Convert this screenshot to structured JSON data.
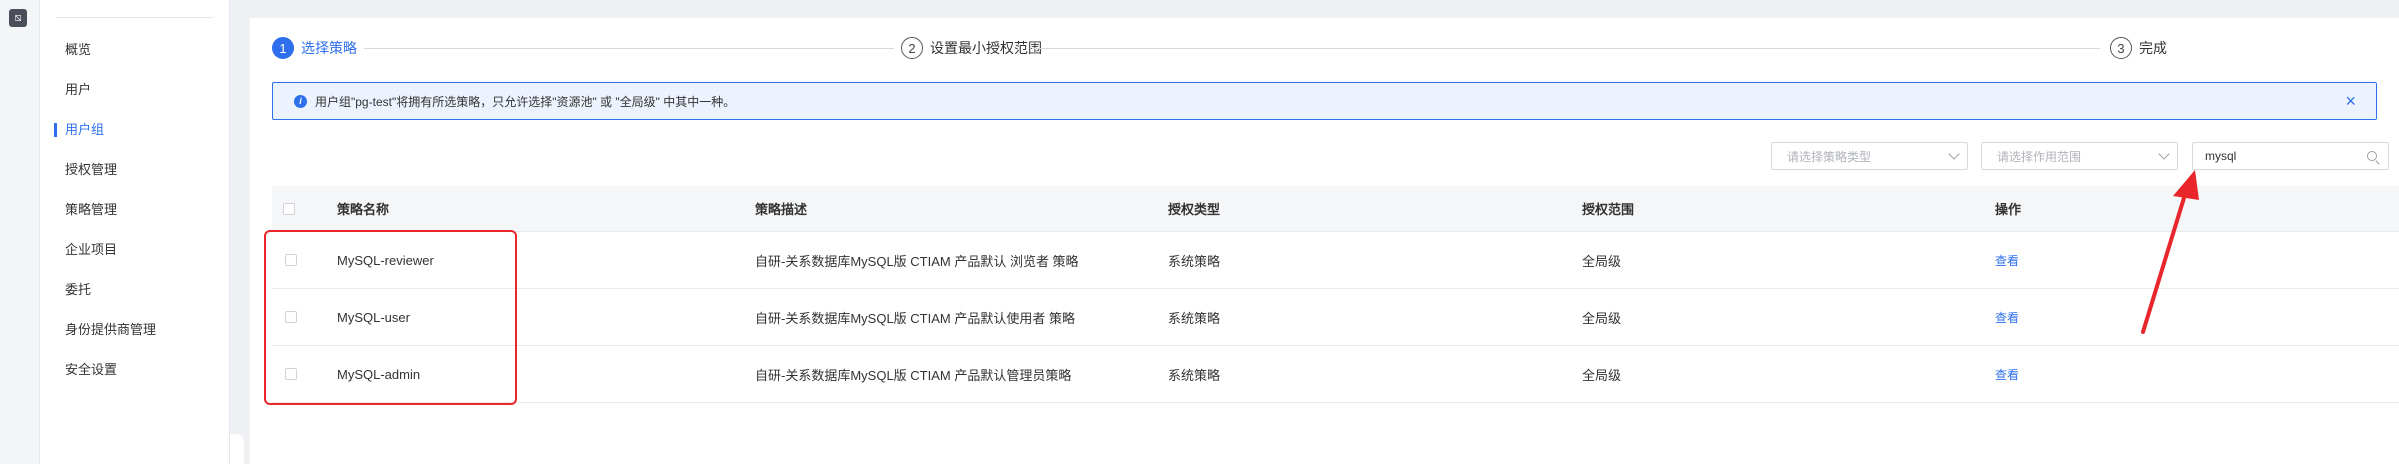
{
  "sidebar": {
    "items": [
      {
        "label": "概览"
      },
      {
        "label": "用户"
      },
      {
        "label": "用户组"
      },
      {
        "label": "授权管理"
      },
      {
        "label": "策略管理"
      },
      {
        "label": "企业项目"
      },
      {
        "label": "委托"
      },
      {
        "label": "身份提供商管理"
      },
      {
        "label": "安全设置"
      }
    ],
    "active_index": 2
  },
  "steps": [
    {
      "number": "1",
      "label": "选择策略",
      "active": true
    },
    {
      "number": "2",
      "label": "设置最小授权范围",
      "active": false
    },
    {
      "number": "3",
      "label": "完成",
      "active": false
    }
  ],
  "alert": {
    "text": "用户组\"pg-test\"将拥有所选策略，只允许选择\"资源池\" 或 \"全局级\" 中其中一种。",
    "icon": "info-icon",
    "close": "×"
  },
  "filters": {
    "policy_type_placeholder": "请选择策略类型",
    "scope_placeholder": "请选择作用范围",
    "search_value": "mysql"
  },
  "table": {
    "columns": [
      "策略名称",
      "策略描述",
      "授权类型",
      "授权范围",
      "操作"
    ],
    "rows": [
      {
        "name": "MySQL-reviewer",
        "description": "自研-关系数据库MySQL版 CTIAM 产品默认 浏览者 策略",
        "type": "系统策略",
        "scope": "全局级",
        "action": "查看"
      },
      {
        "name": "MySQL-user",
        "description": "自研-关系数据库MySQL版 CTIAM 产品默认使用者 策略",
        "type": "系统策略",
        "scope": "全局级",
        "action": "查看"
      },
      {
        "name": "MySQL-admin",
        "description": "自研-关系数据库MySQL版 CTIAM 产品默认管理员策略",
        "type": "系统策略",
        "scope": "全局级",
        "action": "查看"
      }
    ]
  },
  "colors": {
    "accent": "#2f6fed",
    "annotation": "#e8262b"
  }
}
